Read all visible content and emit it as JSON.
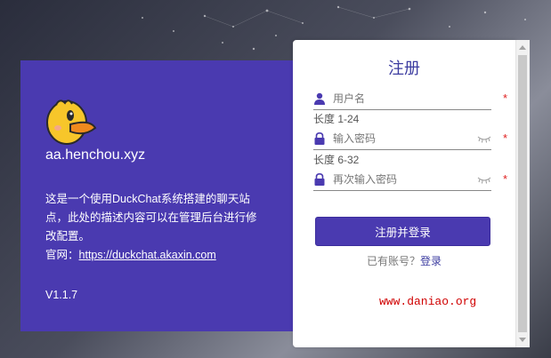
{
  "left": {
    "site_name": "aa.henchou.xyz",
    "description": "这是一个使用DuckChat系统搭建的聊天站点，此处的描述内容可以在管理后台进行修改配置。",
    "official_label": "官网：",
    "official_link": "https://duckchat.akaxin.com",
    "version": "V1.1.7",
    "logo_icon": "duck-logo-icon"
  },
  "form": {
    "title": "注册",
    "username_placeholder": "用户名",
    "username_hint": "长度 1-24",
    "password_placeholder": "输入密码",
    "password_hint": "长度 6-32",
    "confirm_placeholder": "再次输入密码",
    "required_mark": "*",
    "submit_label": "注册并登录",
    "have_account_text": "已有账号？",
    "login_link": "登录",
    "watermark": "www.daniao.org"
  },
  "colors": {
    "accent": "#4a3ab0",
    "title": "#3c3ca0",
    "required": "#e02020"
  }
}
